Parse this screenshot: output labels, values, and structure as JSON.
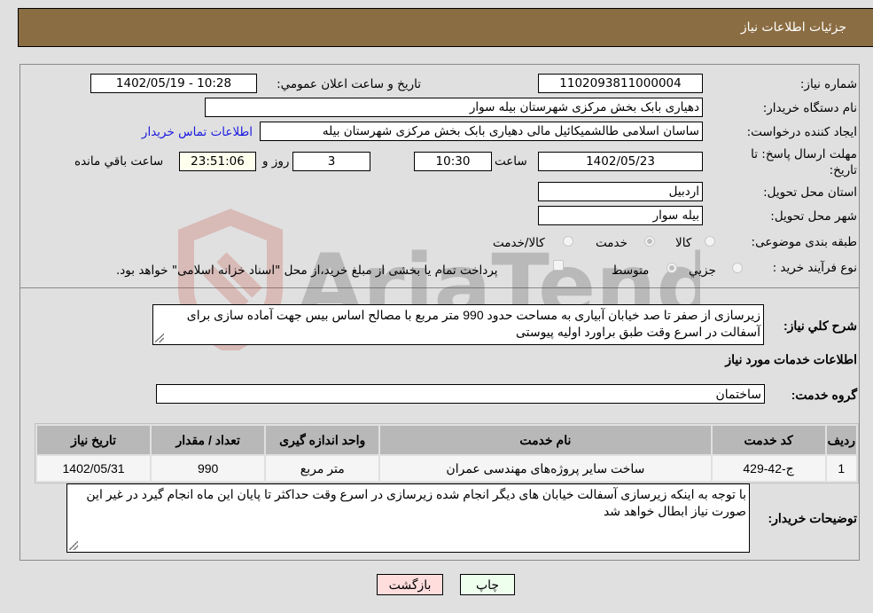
{
  "header": {
    "title": "جزئیات اطلاعات نیاز"
  },
  "form": {
    "need_number": {
      "label": "شماره نیاز:",
      "value": "1102093811000004"
    },
    "announce_datetime": {
      "label": "تاریخ و ساعت اعلان عمومي:",
      "value": "1402/05/19 - 10:28"
    },
    "buyer_org": {
      "label": "نام دستگاه خريدار:",
      "value": "دهیاری بابک بخش مرکزی شهرستان بیله سوار"
    },
    "requester": {
      "label": "ایجاد کننده درخواست:",
      "value": "ساسان اسلامی طالشمیکائیل مالی دهیاری بابک بخش مرکزی شهرستان بیله",
      "contact_link": "اطلاعات تماس خریدار"
    },
    "deadline": {
      "label": "مهلت ارسال پاسخ: تا تاریخ:",
      "date": "1402/05/23",
      "time_label": "ساعت",
      "time": "10:30",
      "days": "3",
      "days_label": "روز و",
      "remaining": "23:51:06",
      "remaining_label": "ساعت باقي مانده"
    },
    "province": {
      "label": "استان محل تحویل:",
      "value": "اردبیل"
    },
    "city": {
      "label": "شهر محل تحویل:",
      "value": "بیله سوار"
    },
    "category": {
      "label": "طبقه بندی موضوعی:",
      "options": [
        "کالا",
        "خدمت",
        "کالا/خدمت"
      ],
      "selected": "خدمت"
    },
    "purchase_type": {
      "label": "نوع فرآیند خرید :",
      "options": [
        "جزيي",
        "متوسط"
      ],
      "selected": "متوسط",
      "treasury_note": "پرداخت تمام یا بخشی از مبلغ خرید،از محل \"اسناد خزانه اسلامی\" خواهد بود."
    }
  },
  "description": {
    "label": "شرح کلي نياز:",
    "value": "زیرسازی از صفر تا صد خیابان آبیاری به مساحت حدود 990 متر مربع با مصالح اساس بیس جهت آماده سازی برای آسفالت در اسرع وقت طبق براورد اولیه پیوستی"
  },
  "services_section": {
    "title": "اطلاعات خدمات مورد نياز"
  },
  "service_group": {
    "label": "گروه خدمت:",
    "value": "ساختمان"
  },
  "table": {
    "headers": [
      "ردیف",
      "کد خدمت",
      "نام خدمت",
      "واحد اندازه گیری",
      "تعداد / مقدار",
      "تاریخ نیاز"
    ],
    "rows": [
      [
        "1",
        "ج-42-429",
        "ساخت سایر پروژه‌های مهندسی عمران",
        "متر مربع",
        "990",
        "1402/05/31"
      ]
    ]
  },
  "buyer_notes": {
    "label": "توضيحات خريدار:",
    "value": "با توجه به اینکه زیرسازی آسفالت خیابان های دیگر انجام شده زیرسازی در اسرع وقت حداکثر تا پایان این ماه انجام گیرد در غیر این صورت نیاز ابطال خواهد شد"
  },
  "buttons": {
    "print": "چاپ",
    "back": "بازگشت"
  },
  "colors": {
    "header_bg": "#8b6d43",
    "link": "#1a1adf",
    "print_bg": "#eeffee",
    "back_bg": "#ffdddd"
  },
  "watermark": {
    "text": "AriaTender.neT"
  }
}
